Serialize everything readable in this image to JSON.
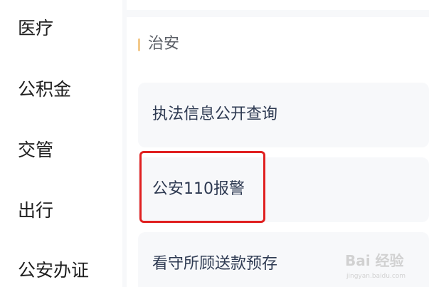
{
  "sidebar": {
    "items": [
      {
        "label": "医疗"
      },
      {
        "label": "公积金"
      },
      {
        "label": "交管"
      },
      {
        "label": "出行"
      },
      {
        "label": "公安办证"
      }
    ]
  },
  "section": {
    "title": "治安",
    "items": [
      {
        "label": "执法信息公开查询"
      },
      {
        "label": "公安110报警"
      },
      {
        "label": "看守所顾送款预存"
      }
    ]
  },
  "watermark": {
    "brand": "Bai 经验",
    "url": "jingyan.baidu.com"
  },
  "colors": {
    "accent_bar": "#f3c98b",
    "highlight": "#e02020",
    "item_bg": "#f7f8fa",
    "item_text": "#2e3a52"
  }
}
